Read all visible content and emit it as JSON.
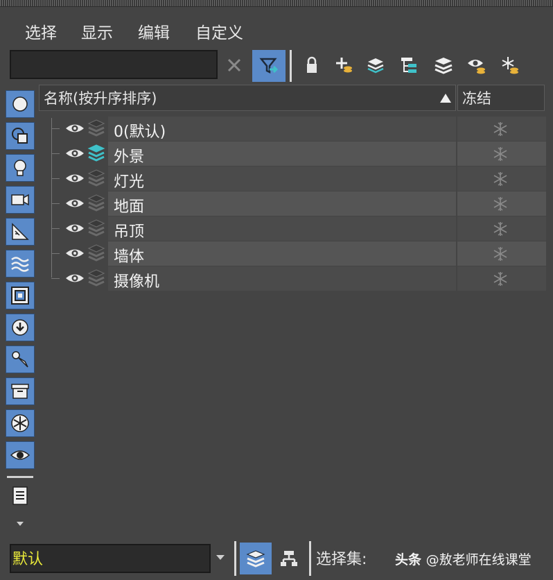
{
  "menu": {
    "items": [
      "选择",
      "显示",
      "编辑",
      "自定义"
    ]
  },
  "toolbar": {
    "search_value": "",
    "icons": [
      "clear-x-icon",
      "filter-icon",
      "lock-icon",
      "add-layer-icon",
      "move-to-layer-icon",
      "hierarchy-icon",
      "layers-icon",
      "eye-layer-icon",
      "freeze-layer-icon"
    ]
  },
  "sidebar": {
    "icons": [
      "circle-icon",
      "shapes-icon",
      "light-bulb-icon",
      "camera-icon",
      "helper-ruler-icon",
      "spacewarp-icon",
      "frame-icon",
      "xref-icon",
      "bone-icon",
      "container-icon",
      "snowflake-icon",
      "eye-icon",
      "document-icon",
      "chevron-down-icon"
    ]
  },
  "columns": {
    "name": "名称(按升序排序)",
    "freeze": "冻结"
  },
  "layers": [
    {
      "name": "0(默认)",
      "active": false
    },
    {
      "name": "外景",
      "active": true
    },
    {
      "name": "灯光",
      "active": false
    },
    {
      "name": "地面",
      "active": false
    },
    {
      "name": "吊顶",
      "active": false
    },
    {
      "name": "墙体",
      "active": false
    },
    {
      "name": "摄像机",
      "active": false
    }
  ],
  "bottom": {
    "current_layer": "默认",
    "selection_set_label": "选择集:",
    "watermark_brand": "头条",
    "watermark_handle": "@敖老师在线课堂"
  },
  "colors": {
    "accent_blue": "#5a8ac9",
    "active_teal": "#3fc1c9",
    "layer_text_yellow": "#e8e83a",
    "background": "#444444"
  }
}
